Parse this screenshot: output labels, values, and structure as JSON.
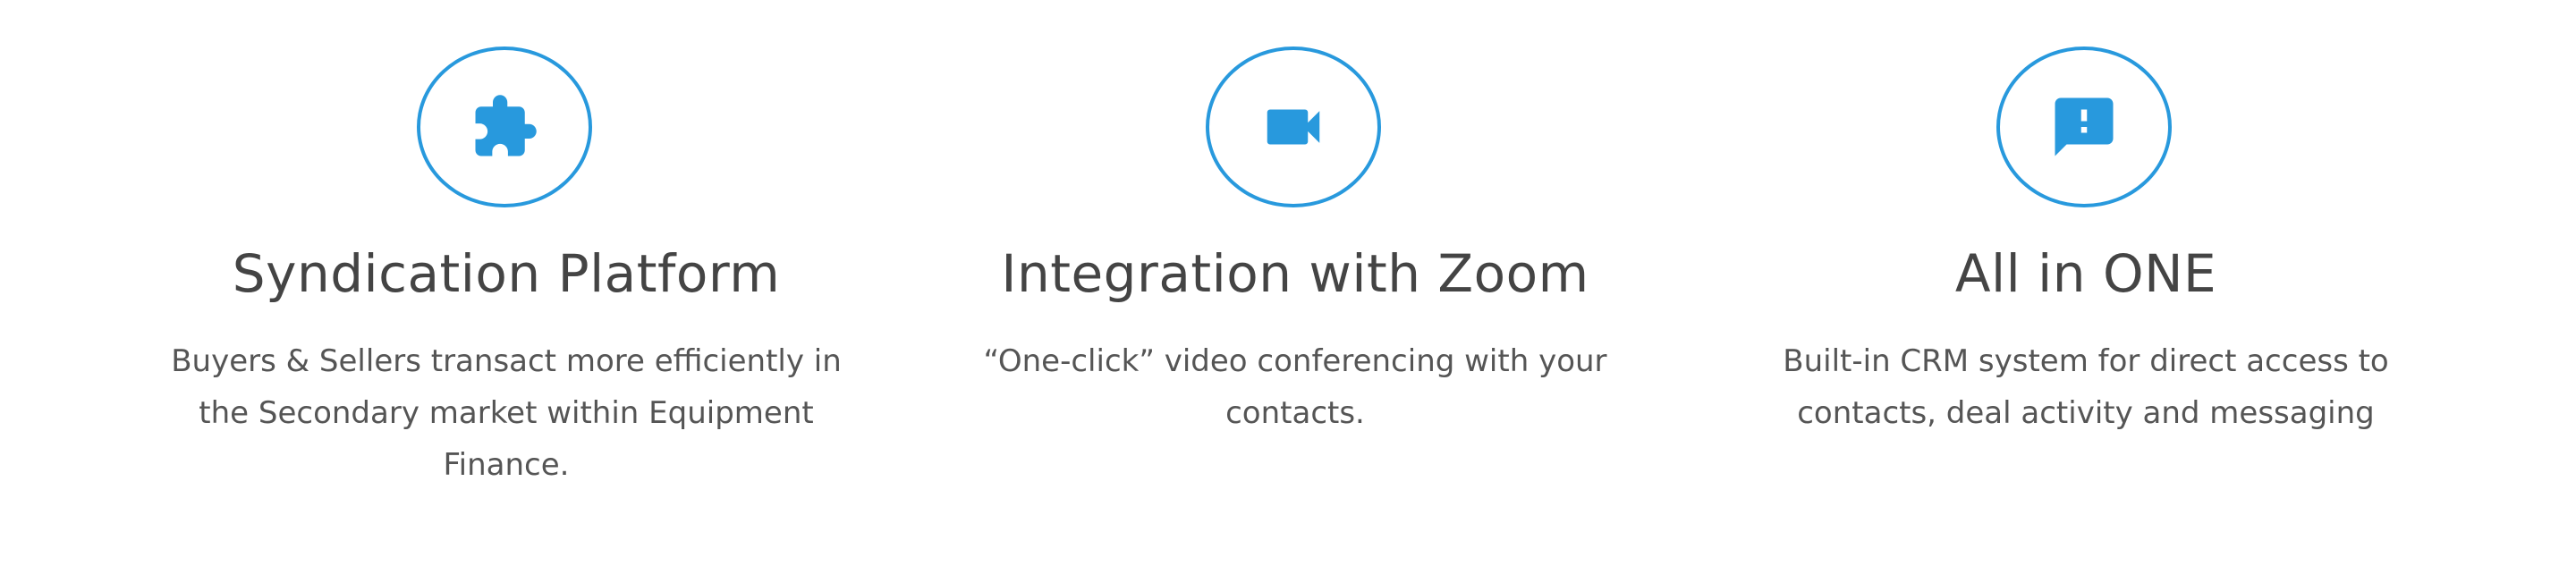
{
  "theme": {
    "accent": "#2899dd",
    "title_color": "#444444",
    "text_color": "#555555",
    "background": "#ffffff"
  },
  "features": [
    {
      "icon": "puzzle-piece-icon",
      "title": "Syndication Platform",
      "description_lines": [
        "Buyers & Sellers transact more efficiently in",
        "the Secondary market within Equipment",
        "Finance."
      ]
    },
    {
      "icon": "video-camera-icon",
      "title": "Integration with Zoom",
      "description_lines": [
        "“One-click” video conferencing with your",
        "contacts."
      ]
    },
    {
      "icon": "message-alert-icon",
      "title": "All in ONE",
      "description_lines": [
        "Built-in CRM system for direct access to",
        "contacts, deal activity and messaging"
      ]
    }
  ]
}
